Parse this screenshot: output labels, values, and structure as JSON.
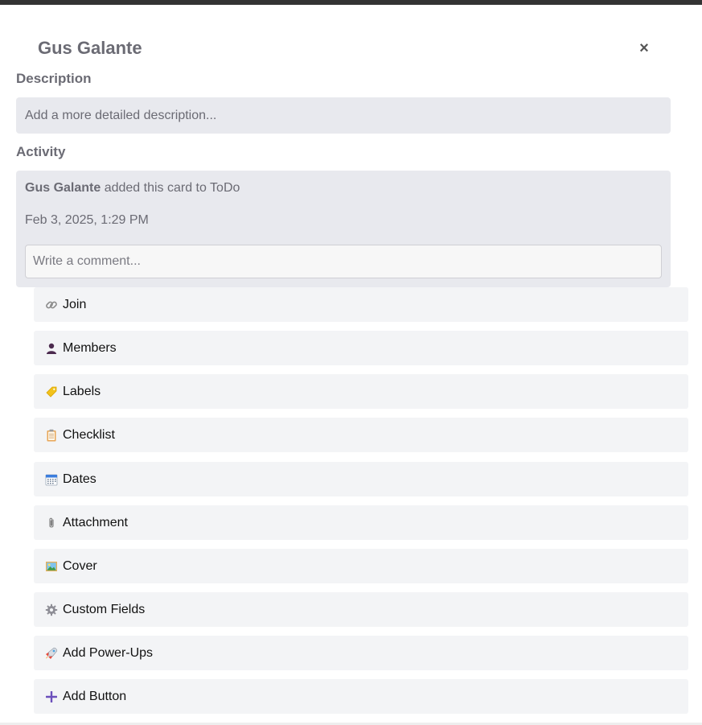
{
  "card": {
    "title": "Gus Galante",
    "close_symbol": "×"
  },
  "description": {
    "heading": "Description",
    "placeholder": "Add a more detailed description..."
  },
  "activity": {
    "heading": "Activity",
    "entry": {
      "user": "Gus Galante",
      "text": " added this card to ToDo",
      "timestamp": "Feb 3, 2025, 1:29 PM"
    },
    "comment_placeholder": "Write a comment..."
  },
  "actions": [
    {
      "label": "Join",
      "icon": "link-icon"
    },
    {
      "label": "Members",
      "icon": "person-icon"
    },
    {
      "label": "Labels",
      "icon": "label-tag-icon"
    },
    {
      "label": "Checklist",
      "icon": "clipboard-icon"
    },
    {
      "label": "Dates",
      "icon": "calendar-icon"
    },
    {
      "label": "Attachment",
      "icon": "paperclip-icon"
    },
    {
      "label": "Cover",
      "icon": "picture-icon"
    },
    {
      "label": "Custom Fields",
      "icon": "gear-icon"
    },
    {
      "label": "Add Power-Ups",
      "icon": "rocket-icon"
    },
    {
      "label": "Add Button",
      "icon": "plus-icon"
    }
  ],
  "colors": {
    "heading_text": "#6b6b74",
    "input_bg": "#e8e9ee",
    "button_bg": "#f3f4f6",
    "plus_accent": "#6b4fbb"
  }
}
